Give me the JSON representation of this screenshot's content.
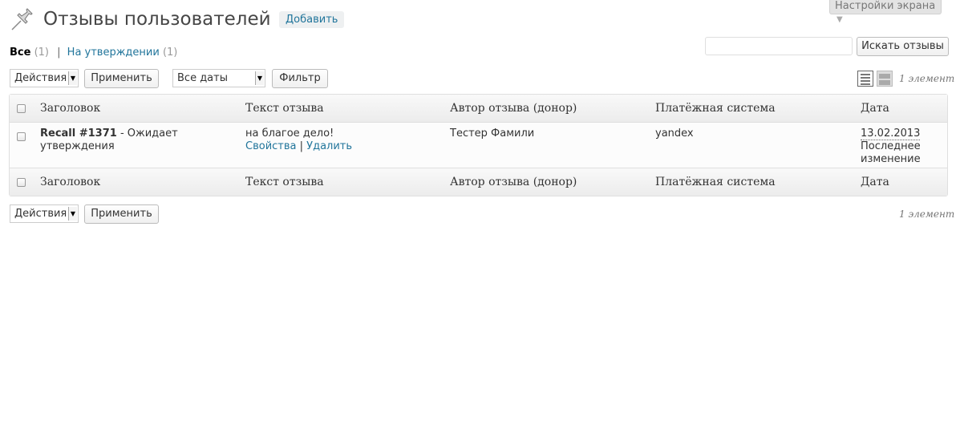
{
  "header": {
    "title": "Отзывы пользователей",
    "add_label": "Добавить",
    "screen_options_label": "Настройки экрана",
    "screen_options_arrow": "▼"
  },
  "views": {
    "all_label": "Все",
    "all_count": "(1)",
    "separator": "|",
    "pending_label": "На утверждении",
    "pending_count": "(1)"
  },
  "search": {
    "value": "",
    "button_label": "Искать отзывы"
  },
  "tablenav_top": {
    "bulk_action_value": "Действия",
    "apply_label": "Применить",
    "date_filter_value": "Все даты",
    "filter_label": "Фильтр",
    "item_count": "1 элемент"
  },
  "tablenav_bottom": {
    "bulk_action_value": "Действия",
    "apply_label": "Применить",
    "item_count": "1 элемент"
  },
  "table": {
    "columns": [
      "Заголовок",
      "Текст отзыва",
      "Автор отзыва (донор)",
      "Платёжная система",
      "Дата"
    ],
    "rows": [
      {
        "title": "Recall #1371",
        "title_suffix": " - Ожидает утверждения",
        "text": "на благое дело!",
        "action_properties": "Свойства",
        "action_separator": "|",
        "action_delete": "Удалить",
        "author": "Тестер Фамили",
        "payment": "yandex",
        "date": "13.02.2013",
        "date_note": "Последнее изменение"
      }
    ]
  },
  "icons": {
    "page_icon": "pushpin-icon",
    "view_list": "list-view-icon",
    "view_excerpt": "excerpt-view-icon"
  },
  "colors": {
    "link": "#21759b",
    "count": "#999999"
  }
}
